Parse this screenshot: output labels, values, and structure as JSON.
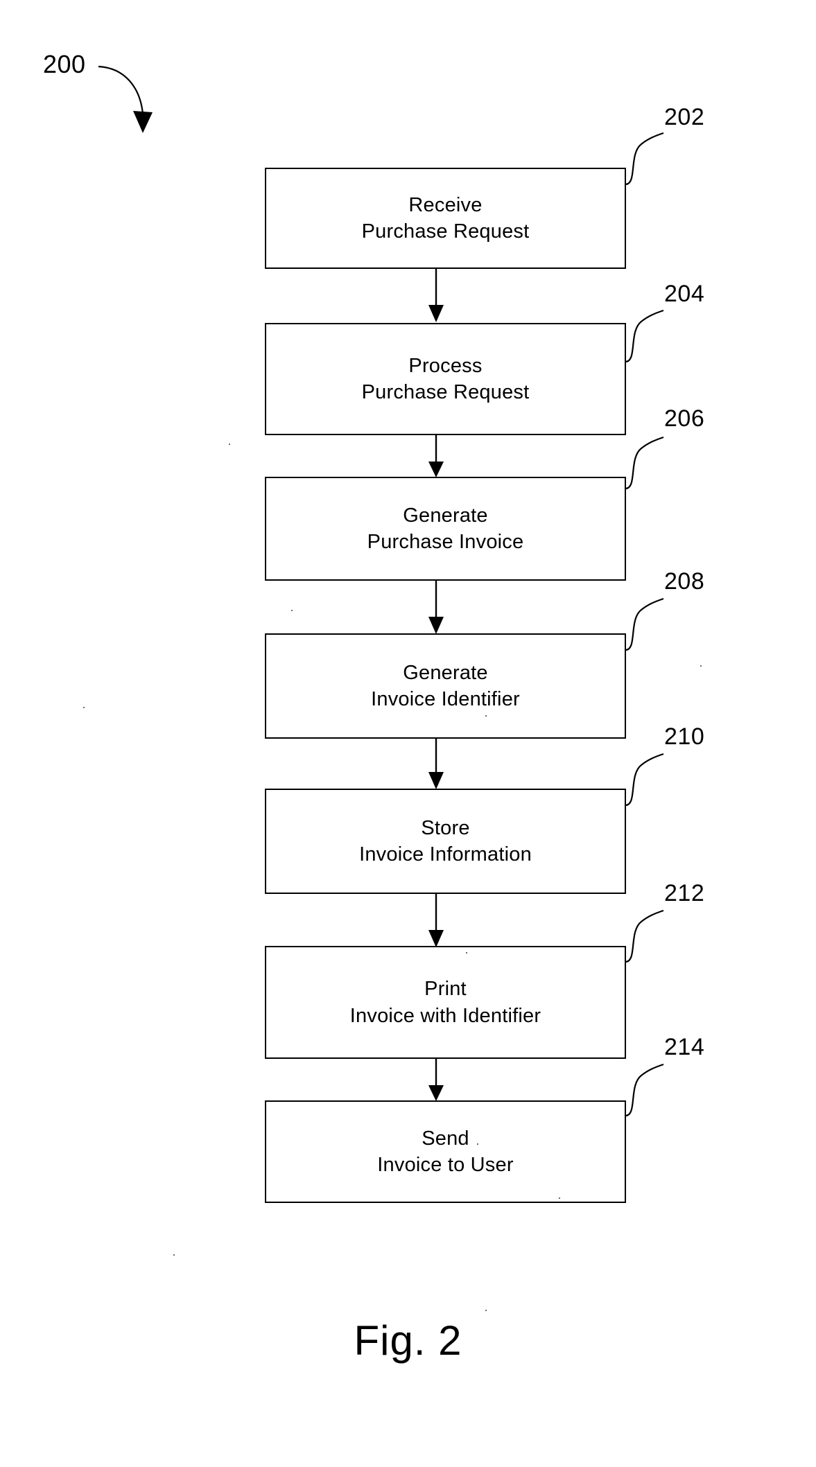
{
  "figure": {
    "number_label": "200",
    "caption": "Fig. 2"
  },
  "flowchart": {
    "type": "flowchart",
    "orientation": "vertical",
    "steps": [
      {
        "ref": "202",
        "line1": "Receive",
        "line2": "Purchase Request"
      },
      {
        "ref": "204",
        "line1": "Process",
        "line2": "Purchase Request"
      },
      {
        "ref": "206",
        "line1": "Generate",
        "line2": "Purchase Invoice"
      },
      {
        "ref": "208",
        "line1": "Generate",
        "line2": "Invoice Identifier"
      },
      {
        "ref": "210",
        "line1": "Store",
        "line2": "Invoice Information"
      },
      {
        "ref": "212",
        "line1": "Print",
        "line2": "Invoice with Identifier"
      },
      {
        "ref": "214",
        "line1": "Send",
        "line2": "Invoice to User"
      }
    ],
    "connectors": [
      {
        "from": "202",
        "to": "204"
      },
      {
        "from": "204",
        "to": "206"
      },
      {
        "from": "206",
        "to": "208"
      },
      {
        "from": "208",
        "to": "210"
      },
      {
        "from": "210",
        "to": "212"
      },
      {
        "from": "212",
        "to": "214"
      }
    ]
  },
  "colors": {
    "ink": "#000000",
    "page": "#ffffff"
  }
}
